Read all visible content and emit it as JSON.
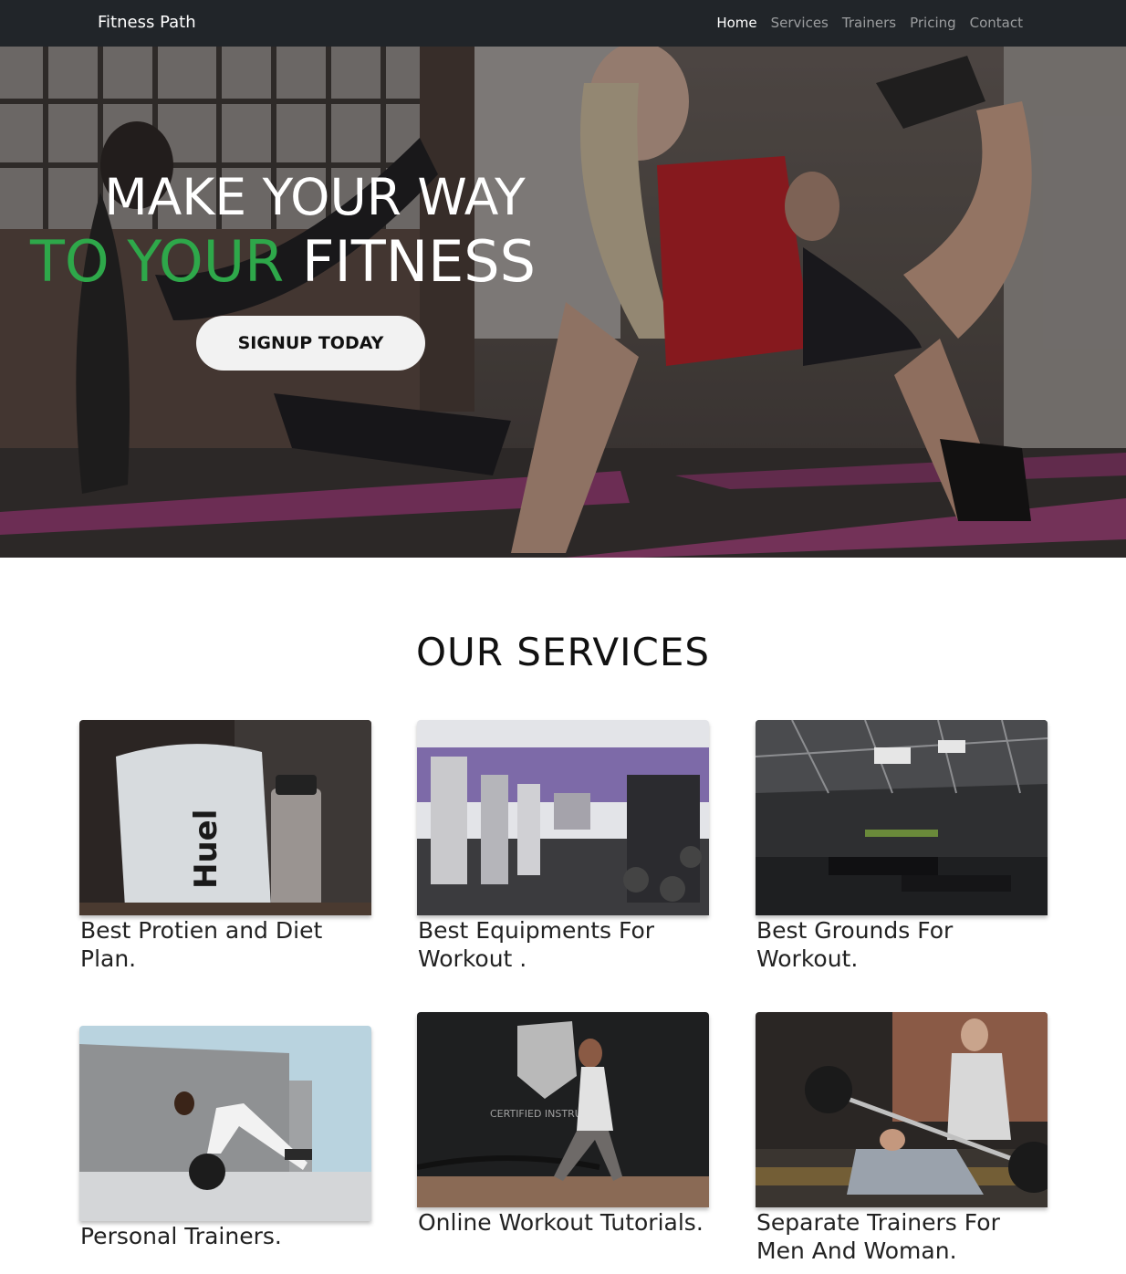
{
  "brand": "Fitness Path",
  "nav": [
    {
      "label": "Home",
      "active": true
    },
    {
      "label": "Services",
      "active": false
    },
    {
      "label": "Trainers",
      "active": false
    },
    {
      "label": "Pricing",
      "active": false
    },
    {
      "label": "Contact",
      "active": false
    }
  ],
  "hero": {
    "line1": "MAKE YOUR WAY",
    "line2_green": "TO YOUR",
    "line2_white": "FITNESS",
    "button": "SIGNUP TODAY",
    "accent_color": "#2ea84a"
  },
  "services": {
    "title": "OUR SERVICES",
    "cards": [
      {
        "caption": "Best Protien and Diet Plan.",
        "image": "protein-shake-photo"
      },
      {
        "caption": "Best Equipments For Workout .",
        "image": "gym-equipment-photo"
      },
      {
        "caption": "Best Grounds For Workout.",
        "image": "gym-hall-photo"
      },
      {
        "caption": "Personal Trainers.",
        "image": "medicine-ball-pushup-photo"
      },
      {
        "caption": "Online Workout Tutorials.",
        "image": "battle-rope-photo"
      },
      {
        "caption": "Separate Trainers For Men And Woman.",
        "image": "bench-press-spotter-photo"
      }
    ]
  }
}
